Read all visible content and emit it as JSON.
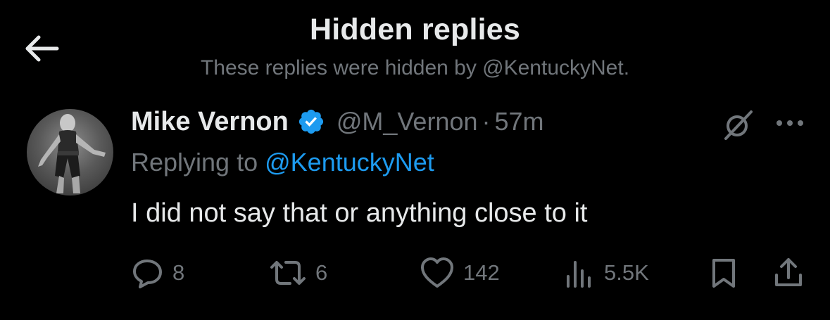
{
  "header": {
    "title": "Hidden replies",
    "subtitle": "These replies were hidden by @KentuckyNet."
  },
  "tweet": {
    "author_name": "Mike Vernon",
    "handle": "@M_Vernon",
    "separator": "·",
    "time": "57m",
    "replying_prefix": "Replying to ",
    "replying_mention": "@KentuckyNet",
    "text": "I did not say that or anything close to it",
    "verified": true,
    "stats": {
      "replies": "8",
      "reposts": "6",
      "likes": "142",
      "views": "5.5K"
    }
  },
  "icons": {
    "back": "arrow-left-icon",
    "verified": "verified-badge-icon",
    "grok": "grok-icon",
    "more": "more-dots-icon",
    "reply": "reply-bubble-icon",
    "repost": "repost-icon",
    "like": "heart-icon",
    "views": "views-bar-icon",
    "bookmark": "bookmark-icon",
    "share": "share-icon"
  },
  "colors": {
    "background": "#000000",
    "primary_text": "#e7e9ea",
    "secondary_text": "#71767b",
    "accent": "#1d9bf0"
  }
}
